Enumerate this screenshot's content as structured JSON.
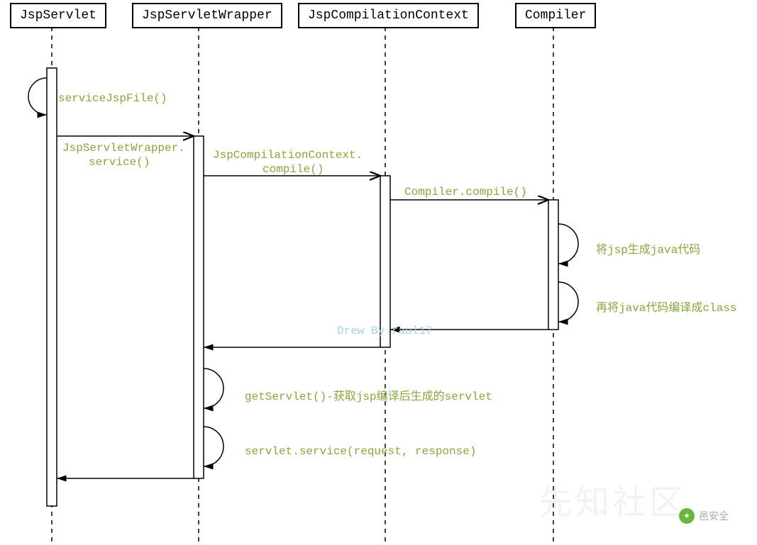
{
  "participants": {
    "p1": "JspServlet",
    "p2": "JspServletWrapper",
    "p3": "JspCompilationContext",
    "p4": "Compiler"
  },
  "messages": {
    "m1": "serviceJspFile()",
    "m2_l1": "JspServletWrapper.",
    "m2_l2": "service()",
    "m3_l1": "JspCompilationContext.",
    "m3_l2": "compile()",
    "m4": "Compiler.compile()",
    "m5": "将jsp生成java代码",
    "m6": "再将java代码编译成class",
    "m7": "getServlet()-获取jsp编译后生成的servlet",
    "m8": "servlet.service(request, response)"
  },
  "watermark": "Drew By raul17",
  "footer": {
    "brand": "邑安全",
    "bg": "先知社区"
  }
}
